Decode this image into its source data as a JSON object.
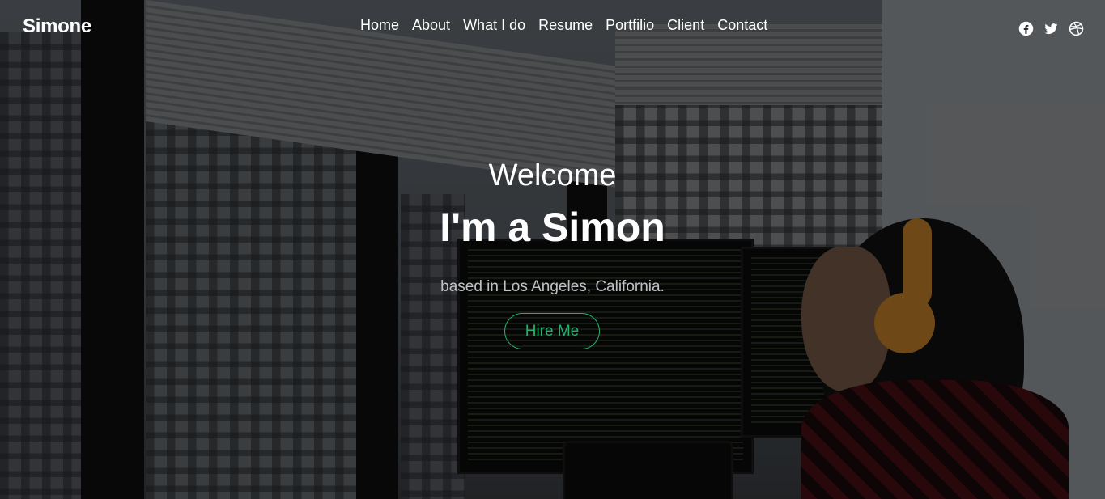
{
  "brand": {
    "name": "Simone"
  },
  "nav": {
    "items": [
      "Home",
      "About",
      "What I do",
      "Resume",
      "Portfilio",
      "Client",
      "Contact"
    ]
  },
  "social": {
    "icons": [
      "facebook-icon",
      "twitter-icon",
      "dribbble-icon"
    ]
  },
  "hero": {
    "welcome": "Welcome",
    "headline": "I'm a Simon",
    "tagline": "based in Los Angeles, California.",
    "cta_label": "Hire Me"
  },
  "colors": {
    "accent": "#20b26b",
    "text": "#ffffff",
    "muted_text": "#bfc2c4"
  }
}
